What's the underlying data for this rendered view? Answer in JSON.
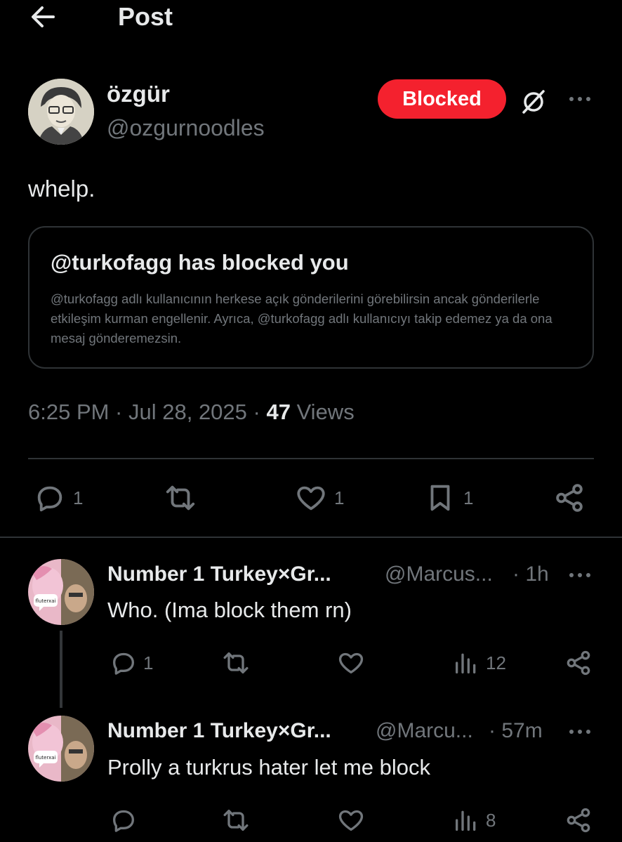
{
  "header": {
    "title": "Post"
  },
  "post": {
    "author_name": "özgür",
    "author_handle": "@ozgurnoodles",
    "blocked_label": "Blocked",
    "text": "whelp.",
    "quote_card": {
      "title": "@turkofagg has blocked you",
      "body": "@turkofagg adlı kullanıcının herkese açık gönderilerini görebilirsin ancak gönderilerle etkileşim kurman engellenir. Ayrıca, @turkofagg adlı kullanıcıyı takip edemez ya da ona mesaj gönderemezsin."
    },
    "timestamp": "6:25 PM · Jul 28, 2025 · ",
    "views_count": "47",
    "views_label": " Views",
    "actions": {
      "replies": "1",
      "reposts": "",
      "likes": "1",
      "bookmarks": "1"
    }
  },
  "replies": [
    {
      "name": "Number 1 Turkey×Gr...",
      "handle": "@Marcus...",
      "time": "· 1h",
      "text": "Who. (Ima block them rn)",
      "avatar_label": "fluterxai",
      "actions": {
        "replies": "1",
        "reposts": "",
        "likes": "",
        "views": "12"
      }
    },
    {
      "name": "Number 1 Turkey×Gr...",
      "handle": "@Marcu...",
      "time": "· 57m",
      "text": "Prolly a turkrus hater let me block",
      "avatar_label": "fluterxai",
      "actions": {
        "replies": "",
        "reposts": "",
        "likes": "",
        "views": "8"
      }
    }
  ],
  "colors": {
    "background": "#000000",
    "text": "#e7e9ea",
    "muted": "#71767b",
    "blocked": "#f4212e",
    "border": "#2f3336"
  },
  "icons": [
    "back-arrow-icon",
    "grok-icon",
    "more-icon",
    "reply-icon",
    "repost-icon",
    "like-icon",
    "bookmark-icon",
    "share-icon",
    "views-icon"
  ]
}
